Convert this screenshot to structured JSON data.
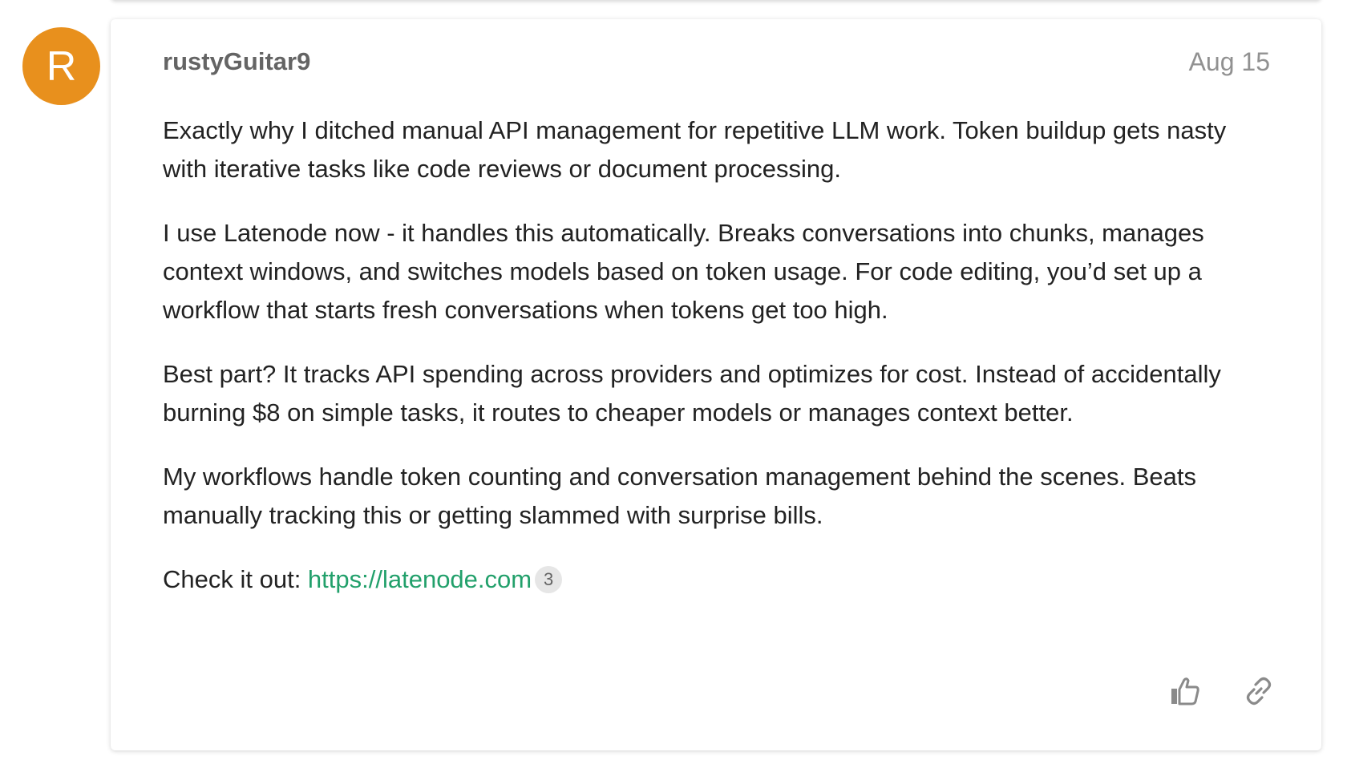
{
  "previous_post": {},
  "post": {
    "avatar_letter": "R",
    "avatar_color": "#e8901d",
    "username": "rustyGuitar9",
    "date": "Aug 15",
    "paragraphs": [
      "Exactly why I ditched manual API management for repetitive LLM work. Token buildup gets nasty with iterative tasks like code reviews or document processing.",
      "I use Latenode now - it handles this automatically. Breaks conversations into chunks, manages context windows, and switches models based on token usage. For code editing, you’d set up a workflow that starts fresh conversations when tokens get too high.",
      "Best part? It tracks API spending across providers and optimizes for cost. Instead of accidentally burning $8 on simple tasks, it routes to cheaper models or manages context better.",
      "My workflows handle token counting and conversation management behind the scenes. Beats manually tracking this or getting slammed with surprise bills."
    ],
    "link_prefix": "Check it out: ",
    "link_text": "https://latenode.com",
    "link_click_count": "3",
    "link_color": "#22a06b",
    "actions": {
      "like_icon": "thumbs-up-icon",
      "share_icon": "link-icon"
    }
  }
}
